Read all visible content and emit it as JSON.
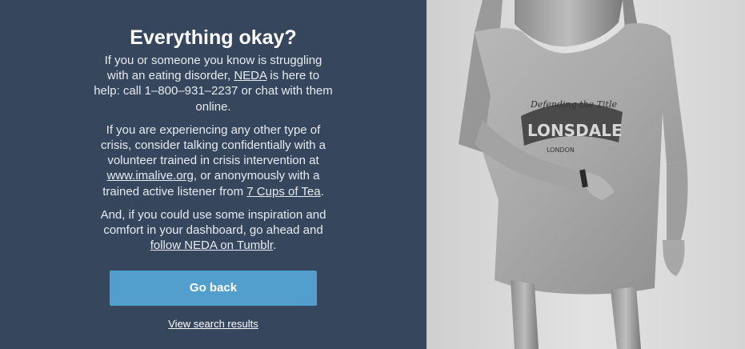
{
  "heading": "Everything okay?",
  "paragraph1": {
    "before": "If you or someone you know is struggling with an eating disorder, ",
    "link": "NEDA",
    "after": " is here to help: call 1–800–931–2237 or chat with them online."
  },
  "paragraph2": {
    "before": "If you are experiencing any other type of crisis, consider talking confidentially with a volunteer trained in crisis intervention at ",
    "link1": "www.imalive.org",
    "middle": ", or anonymously with a trained active listener from ",
    "link2": "7 Cups of Tea",
    "after": "."
  },
  "paragraph3": {
    "before": "And, if you could use some inspiration and comfort in your dashboard, go ahead and ",
    "link": "follow NEDA on Tumblr",
    "after": "."
  },
  "go_back_label": "Go back",
  "view_results_label": "View search results",
  "shirt_text": {
    "line1": "Defending the Title",
    "line2": "LONSDALE",
    "line3": "LONDON"
  },
  "colors": {
    "panel_bg": "#36465d",
    "button_bg": "#529ecc"
  }
}
